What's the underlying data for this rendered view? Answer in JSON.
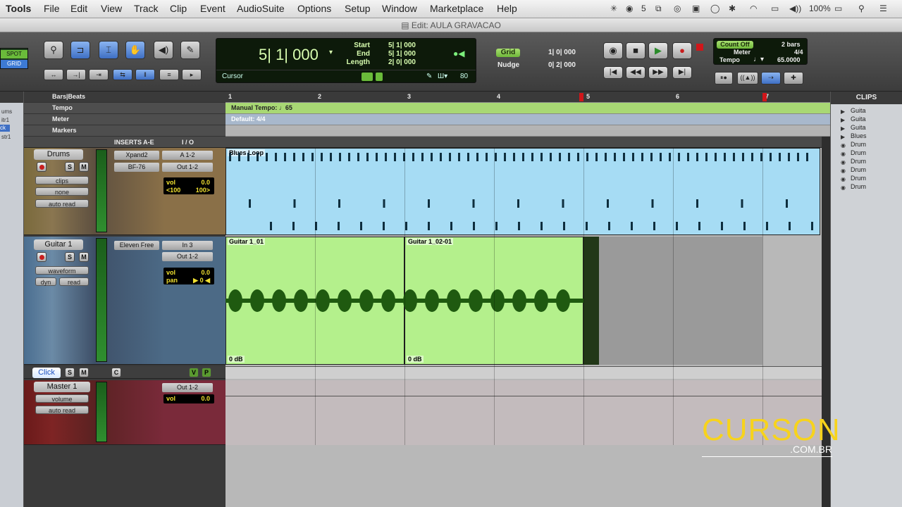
{
  "menubar": {
    "app": "Tools",
    "items": [
      "File",
      "Edit",
      "View",
      "Track",
      "Clip",
      "Event",
      "AudioSuite",
      "Options",
      "Setup",
      "Window",
      "Marketplace",
      "Help"
    ],
    "status": {
      "sync_count": "5",
      "battery": "100%"
    }
  },
  "window": {
    "title": "Edit: AULA GRAVACAO"
  },
  "toolbar": {
    "mode_spot": "SPOT",
    "mode_grid": "GRID",
    "counter_main": "5| 1| 000",
    "start_label": "Start",
    "end_label": "End",
    "length_label": "Length",
    "start_value": "5| 1| 000",
    "end_value": "5| 1| 000",
    "length_value": "2| 0| 000",
    "cursor_label": "Cursor",
    "cursor_value": "80",
    "grid_label": "Grid",
    "grid_value": "1| 0| 000",
    "nudge_label": "Nudge",
    "nudge_value": "0| 2| 000",
    "count_off": "Count Off",
    "count_bars": "2 bars",
    "meter_label": "Meter",
    "meter_value": "4/4",
    "tempo_label": "Tempo",
    "tempo_value": "65.0000"
  },
  "rulers": {
    "bars_label": "Bars|Beats",
    "tempo_label": "Tempo",
    "meter_label": "Meter",
    "markers_label": "Markers",
    "tempo_event": "Manual Tempo: ♩65",
    "meter_event": "Default: 4/4",
    "bars": [
      "1",
      "2",
      "3",
      "4",
      "5",
      "6",
      "7"
    ]
  },
  "header_cols": {
    "inserts": "INSERTS A-E",
    "io": "I / O"
  },
  "tracks": {
    "drums": {
      "name": "Drums",
      "view": "clips",
      "sub": "none",
      "automation": "auto read",
      "inserts": [
        "Xpand2",
        "BF-76"
      ],
      "output": "A 1-2",
      "bus": "Out 1-2",
      "vol_label": "vol",
      "vol_value": "0.0",
      "pan_left": "<100",
      "pan_right": "100>",
      "clip_name": "Blues Loop"
    },
    "guitar": {
      "name": "Guitar 1",
      "view": "waveform",
      "dyn": "dyn",
      "automation": "read",
      "inserts": [
        "Eleven Free"
      ],
      "input": "In 3",
      "output": "Out 1-2",
      "vol_label": "vol",
      "vol_value": "0.0",
      "pan_label": "pan",
      "pan_value": "▶ 0 ◀",
      "clip1": "Guitar 1_01",
      "clip2": "Guitar 1_02-01",
      "gain1": "0 dB",
      "gain2": "0 dB"
    },
    "click": {
      "name": "Click",
      "vp": "V",
      "p": "P"
    },
    "master": {
      "name": "Master 1",
      "view": "volume",
      "automation": "auto read",
      "output": "Out 1-2",
      "vol_label": "vol",
      "vol_value": "0.0"
    }
  },
  "clips_panel": {
    "title": "CLIPS",
    "items": [
      "Guita",
      "Guita",
      "Guita",
      "Blues",
      "Drum",
      "Drum",
      "Drum",
      "Drum",
      "Drum",
      "Drum"
    ]
  },
  "left_strip": [
    "ums",
    "itr1",
    "ck",
    "str1"
  ],
  "watermark": {
    "brand": "CURSON",
    "domain": ".COM.BR"
  }
}
